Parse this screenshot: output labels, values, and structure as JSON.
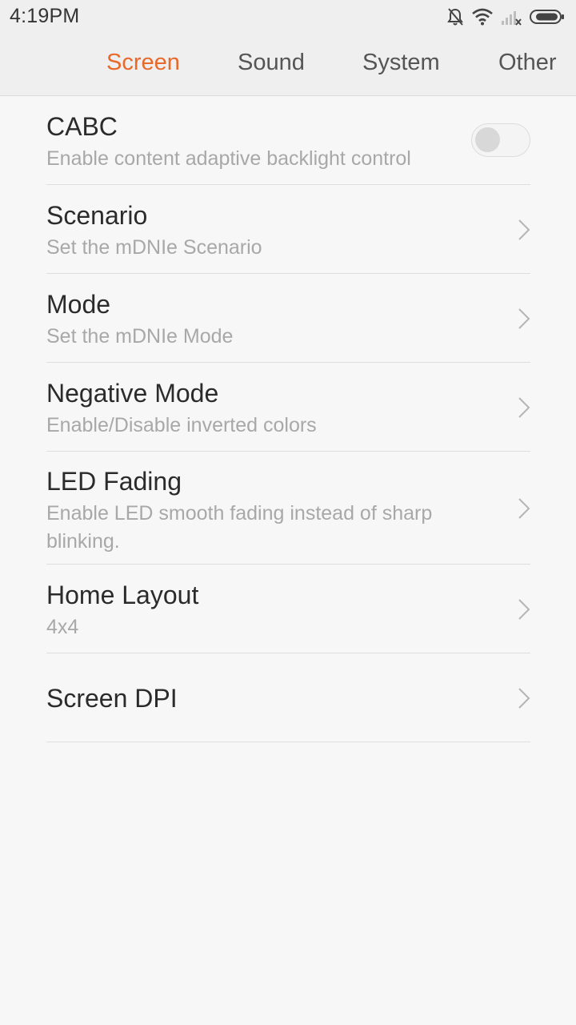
{
  "status_bar": {
    "time": "4:19PM",
    "icons": [
      "bell-muted-icon",
      "wifi-icon",
      "signal-icon",
      "battery-icon"
    ]
  },
  "tabs": [
    {
      "label": "Screen",
      "active": true
    },
    {
      "label": "Sound",
      "active": false
    },
    {
      "label": "System",
      "active": false
    },
    {
      "label": "Other",
      "active": false
    }
  ],
  "settings": [
    {
      "title": "CABC",
      "subtitle": "Enable content adaptive backlight control",
      "control": "toggle",
      "value": false
    },
    {
      "title": "Scenario",
      "subtitle": "Set the mDNIe Scenario",
      "control": "chevron-right-icon"
    },
    {
      "title": "Mode",
      "subtitle": "Set the mDNIe Mode",
      "control": "chevron-right-icon"
    },
    {
      "title": "Negative Mode",
      "subtitle": "Enable/Disable inverted colors",
      "control": "chevron-right-icon"
    },
    {
      "title": "LED Fading",
      "subtitle": "Enable LED smooth fading instead of sharp blinking.",
      "control": "chevron-right-icon"
    },
    {
      "title": "Home Layout",
      "subtitle": "4x4",
      "control": "chevron-right-icon"
    },
    {
      "title": "Screen DPI",
      "subtitle": "",
      "control": "chevron-right-icon"
    }
  ],
  "colors": {
    "accent": "#e86a2b",
    "background": "#f7f7f7",
    "header": "#efefef"
  }
}
